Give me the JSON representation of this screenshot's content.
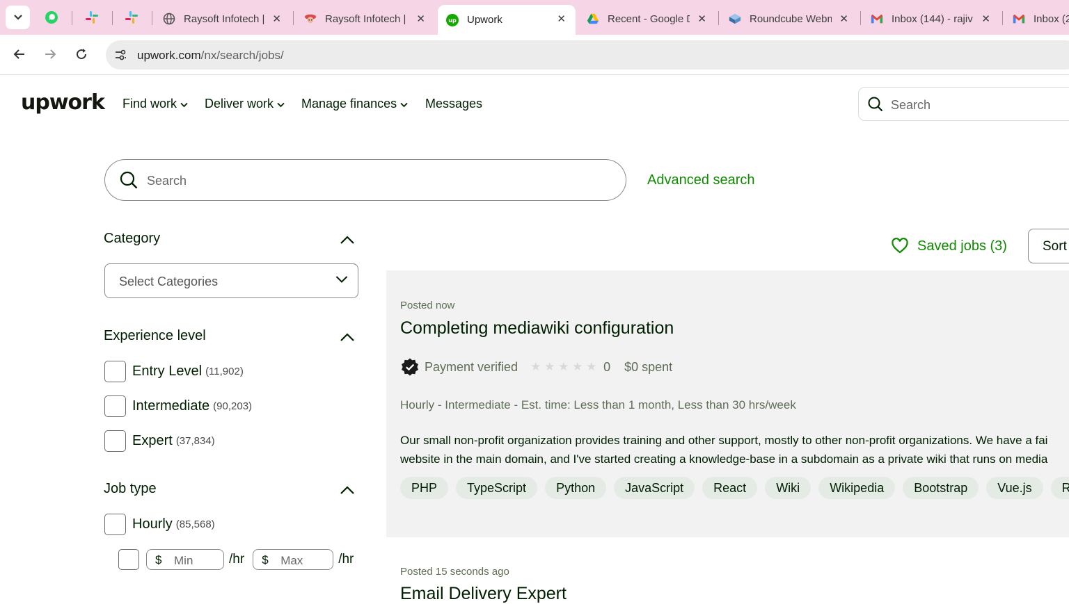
{
  "browser": {
    "tabs": [
      {
        "title": "Raysoft Infotech |",
        "favicon": "globe-icon"
      },
      {
        "title": "Raysoft Infotech |",
        "favicon": "raysoft-icon"
      },
      {
        "title": "Upwork",
        "favicon": "upwork-icon",
        "active": true
      },
      {
        "title": "Recent - Google D",
        "favicon": "drive-icon"
      },
      {
        "title": "Roundcube Webm",
        "favicon": "roundcube-icon"
      },
      {
        "title": "Inbox (144) - rajiv",
        "favicon": "gmail-icon"
      },
      {
        "title": "Inbox (2",
        "favicon": "gmail-icon"
      }
    ],
    "url_domain": "upwork.com",
    "url_path": "/nx/search/jobs/"
  },
  "header": {
    "logo": "upwork",
    "nav": [
      "Find work",
      "Deliver work",
      "Manage finances",
      "Messages"
    ],
    "search_placeholder": "Search"
  },
  "search": {
    "placeholder": "Search",
    "advanced_label": "Advanced search"
  },
  "filters": {
    "category": {
      "title": "Category",
      "select_value": "Select Categories"
    },
    "experience": {
      "title": "Experience level",
      "options": [
        {
          "label": "Entry Level",
          "count": "(11,902)"
        },
        {
          "label": "Intermediate",
          "count": "(90,203)"
        },
        {
          "label": "Expert",
          "count": "(37,834)"
        }
      ]
    },
    "job_type": {
      "title": "Job type",
      "hourly_label": "Hourly",
      "hourly_count": "(85,568)",
      "currency": "$",
      "min_placeholder": "Min",
      "max_placeholder": "Max",
      "per_hour": "/hr"
    }
  },
  "results": {
    "saved_jobs_label": "Saved jobs (3)",
    "sort_label": "Sort",
    "jobs": [
      {
        "posted": "Posted now",
        "title": "Completing mediawiki configuration",
        "payment": "Payment verified",
        "rating": "0",
        "rating_stars_filled": 0,
        "spent": "$0 spent",
        "meta": "Hourly - Intermediate - Est. time: Less than 1 month, Less than 30 hrs/week",
        "description_line1": "Our small non-profit organization provides training and other support, mostly to other non-profit organizations. We have a fai",
        "description_line2": "website in the main domain, and I've started creating a knowledge-base in a subdomain as a private wiki that runs on media",
        "tags": [
          "PHP",
          "TypeScript",
          "Python",
          "JavaScript",
          "React",
          "Wiki",
          "Wikipedia",
          "Bootstrap",
          "Vue.js",
          "R"
        ]
      },
      {
        "posted": "Posted 15 seconds ago",
        "title": "Email Delivery Expert"
      }
    ]
  },
  "colors": {
    "brand_green": "#108a00",
    "tab_strip": "#f6d6e6",
    "card_bg": "#f2f2f2",
    "tag_bg": "#e4ebe4"
  }
}
